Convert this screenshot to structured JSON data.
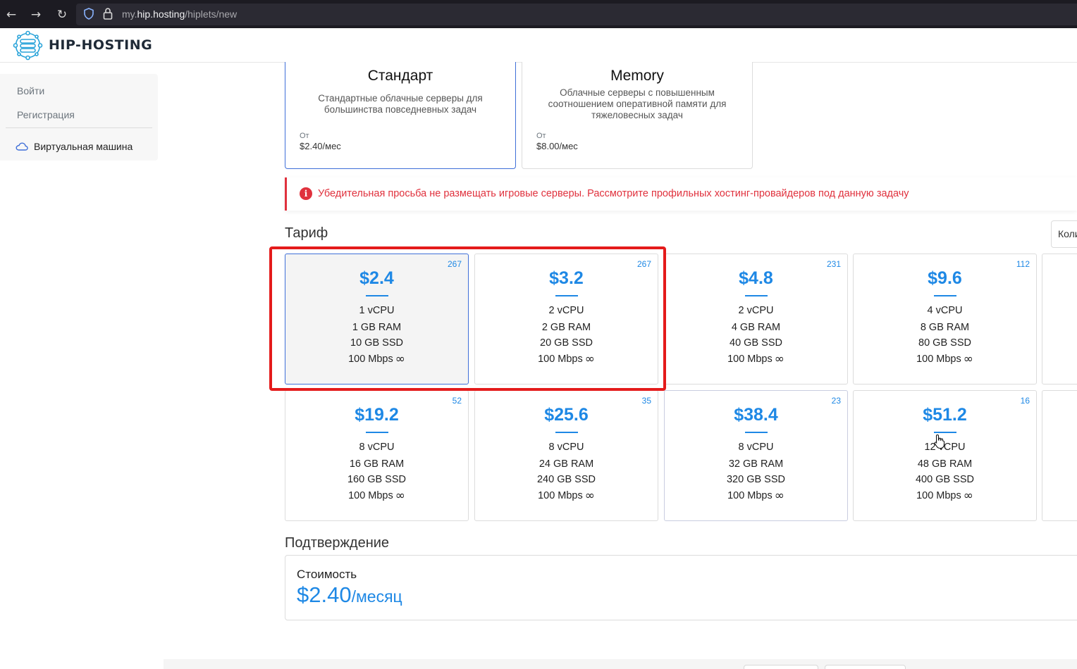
{
  "browser": {
    "back_glyph": "←",
    "forward_glyph": "→",
    "reload_glyph": "↻",
    "url_prefix": "my.",
    "url_domain": "hip.hosting",
    "url_path": "/hiplets/new",
    "icons": [
      "back-icon",
      "forward-icon",
      "reload-icon",
      "shield-icon",
      "lock-icon"
    ]
  },
  "brand": {
    "name": "HIP-HOSTING",
    "accent": "#1e88e5"
  },
  "sidebar": {
    "login": "Войти",
    "register": "Регистрация",
    "vm": "Виртуальная машина"
  },
  "categories": [
    {
      "title": "Стандарт",
      "desc": "Стандартные облачные серверы для большинства повседневных задач",
      "from": "От",
      "price": "$2.40/мес"
    },
    {
      "title": "Memory",
      "desc": "Облачные серверы с повышенным соотношением оперативной памяти для тяжеловесных задач",
      "from": "От",
      "price": "$8.00/мес"
    }
  ],
  "alert": {
    "text": "Убедительная просьба не размещать игровые серверы. Рассмотрите профильных хостинг-провайдеров под данную задачу",
    "color": "#e0313d"
  },
  "tariff_section": {
    "title": "Тариф",
    "qty_label": "Коли"
  },
  "tariffs": [
    {
      "price": "$2.4",
      "count": "267",
      "cpu": "1 vCPU",
      "ram": "1 GB RAM",
      "ssd": "10 GB SSD",
      "net": "100 Mbps"
    },
    {
      "price": "$3.2",
      "count": "267",
      "cpu": "2 vCPU",
      "ram": "2 GB RAM",
      "ssd": "20 GB SSD",
      "net": "100 Mbps"
    },
    {
      "price": "$4.8",
      "count": "231",
      "cpu": "2 vCPU",
      "ram": "4 GB RAM",
      "ssd": "40 GB SSD",
      "net": "100 Mbps"
    },
    {
      "price": "$9.6",
      "count": "112",
      "cpu": "4 vCPU",
      "ram": "8 GB RAM",
      "ssd": "80 GB SSD",
      "net": "100 Mbps"
    },
    {
      "price": "$19.2",
      "count": "52",
      "cpu": "8 vCPU",
      "ram": "16 GB RAM",
      "ssd": "160 GB SSD",
      "net": "100 Mbps"
    },
    {
      "price": "$25.6",
      "count": "35",
      "cpu": "8 vCPU",
      "ram": "24 GB RAM",
      "ssd": "240 GB SSD",
      "net": "100 Mbps"
    },
    {
      "price": "$38.4",
      "count": "23",
      "cpu": "8 vCPU",
      "ram": "32 GB RAM",
      "ssd": "320 GB SSD",
      "net": "100 Mbps"
    },
    {
      "price": "$51.2",
      "count": "16",
      "cpu": "12 vCPU",
      "ram": "48 GB RAM",
      "ssd": "400 GB SSD",
      "net": "100 Mbps"
    }
  ],
  "infinity_glyph": "∞",
  "confirm": {
    "title": "Подтверждение",
    "cost_label": "Стоимость",
    "cost_value": "$2.40",
    "cost_period": "/месяц"
  }
}
